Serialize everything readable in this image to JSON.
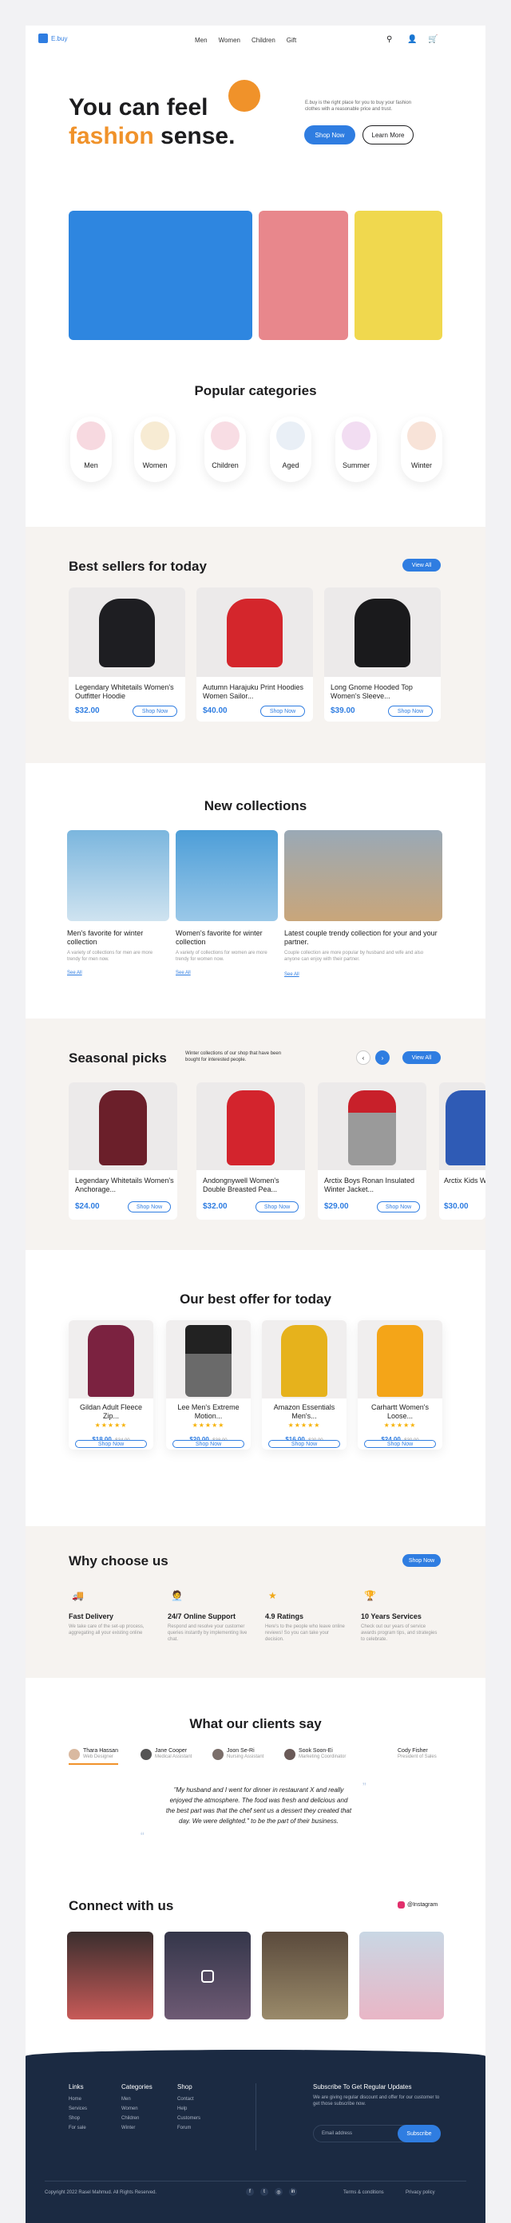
{
  "brand": {
    "name": "E.buy"
  },
  "nav": [
    "Men",
    "Women",
    "Children",
    "Gift"
  ],
  "hero": {
    "title_1": "You can feel",
    "title_2a": "fashion",
    "title_2b": "sense.",
    "desc": "E.buy is the right place for you to buy your fashion clothes with a reasonable price and trust.",
    "shop": "Shop Now",
    "learn": "Learn More"
  },
  "categories": {
    "title": "Popular categories",
    "items": [
      "Men",
      "Women",
      "Children",
      "Aged",
      "Summer",
      "Winter"
    ]
  },
  "best": {
    "title": "Best sellers for today",
    "view_all": "View All",
    "items": [
      {
        "name": "Legendary Whitetails Women's Outfitter Hoodie",
        "price": "$32.00",
        "btn": "Shop Now"
      },
      {
        "name": "Autumn Harajuku Print Hoodies Women Sailor...",
        "price": "$40.00",
        "btn": "Shop Now"
      },
      {
        "name": "Long Gnome Hooded Top Women's Sleeve...",
        "price": "$39.00",
        "btn": "Shop Now"
      }
    ]
  },
  "collections": {
    "title": "New collections",
    "items": [
      {
        "name": "Men's favorite for winter collection",
        "desc": "A variety of collections for men are more trendy for men now.",
        "link": "See All"
      },
      {
        "name": "Women's favorite for winter collection",
        "desc": "A variety of collections for women are more trendy for women now.",
        "link": "See All"
      },
      {
        "name": "Latest couple trendy collection for your and your partner.",
        "desc": "Couple collection are more popular by husband and wife and also anyone can enjoy with their partner.",
        "link": "See All"
      }
    ]
  },
  "seasonal": {
    "title": "Seasonal picks",
    "desc": "Winter collections of our shop that have been bought for interested people.",
    "view_all": "View All",
    "items": [
      {
        "name": "Legendary Whitetails Women's Anchorage...",
        "price": "$24.00",
        "btn": "Shop Now"
      },
      {
        "name": "Andongnywell Women's Double Breasted Pea...",
        "price": "$32.00",
        "btn": "Shop Now"
      },
      {
        "name": "Arctix Boys Ronan Insulated Winter Jacket...",
        "price": "$29.00",
        "btn": "Shop Now"
      },
      {
        "name": "Arctix Kids Winter Ja...",
        "price": "$30.00",
        "btn": "Shop Now"
      }
    ]
  },
  "offer": {
    "title": "Our best offer for today",
    "items": [
      {
        "name": "Gildan Adult Fleece Zip...",
        "price": "$18.00",
        "old": "$34.00",
        "btn": "Shop Now"
      },
      {
        "name": "Lee Men's Extreme Motion...",
        "price": "$20.00",
        "old": "$38.00",
        "btn": "Shop Now"
      },
      {
        "name": "Amazon Essentials Men's...",
        "price": "$16.00",
        "old": "$20.00",
        "btn": "Shop Now"
      },
      {
        "name": "Carhartt Women's Loose...",
        "price": "$24.00",
        "old": "$30.00",
        "btn": "Shop Now"
      }
    ]
  },
  "why": {
    "title": "Why choose us",
    "btn": "Shop Now",
    "items": [
      {
        "name": "Fast Delivery",
        "desc": "We take care of the set-up process, aggregating all your existing online"
      },
      {
        "name": "24/7 Online Support",
        "desc": "Respond and resolve your customer queries instantly by implementing live chat."
      },
      {
        "name": "4.9 Ratings",
        "desc": "Here's to the people who leave online reviews! So you can take your decision."
      },
      {
        "name": "10 Years Services",
        "desc": "Check out our years of service awards program tips, and strategies to celebrate."
      }
    ]
  },
  "clients": {
    "title": "What our clients say",
    "people": [
      {
        "name": "Thara Hassan",
        "role": "Web Designer"
      },
      {
        "name": "Jane Cooper",
        "role": "Medical Assistant"
      },
      {
        "name": "Joon Se-Ri",
        "role": "Nursing Assistant"
      },
      {
        "name": "Sook Soon-Ei",
        "role": "Marketing Coordinator"
      },
      {
        "name": "Cody Fisher",
        "role": "President of Sales"
      }
    ],
    "quote": "\"My husband and I went for dinner in restaurant X and really enjoyed the atmosphere. The food was fresh and delicious and the best part was that the chef sent us a dessert they created that day. We were delighted.\" to be the part of their business."
  },
  "connect": {
    "title": "Connect with us",
    "handle": "@Instagram"
  },
  "footer": {
    "cols": [
      {
        "h": "Links",
        "items": [
          "Home",
          "Services",
          "Shop",
          "For sale"
        ]
      },
      {
        "h": "Categories",
        "items": [
          "Men",
          "Women",
          "Children",
          "Winter"
        ]
      },
      {
        "h": "Shop",
        "items": [
          "Contact",
          "Help",
          "Customers",
          "Forum"
        ]
      }
    ],
    "sub_title": "Subscribe To Get Regular Updates",
    "sub_desc": "We are giving regular discount and offer for our customer to get those subscribe now.",
    "email_ph": "Email address",
    "sub_btn": "Subscribe",
    "copyright": "Copyright 2022 Rasel Mahmud. All Rights Reserved.",
    "terms": "Terms & conditions",
    "privacy": "Privacy policy"
  },
  "colors": {
    "accent": "#2f7de1",
    "orange": "#f0922a",
    "navy": "#1b2a42"
  }
}
